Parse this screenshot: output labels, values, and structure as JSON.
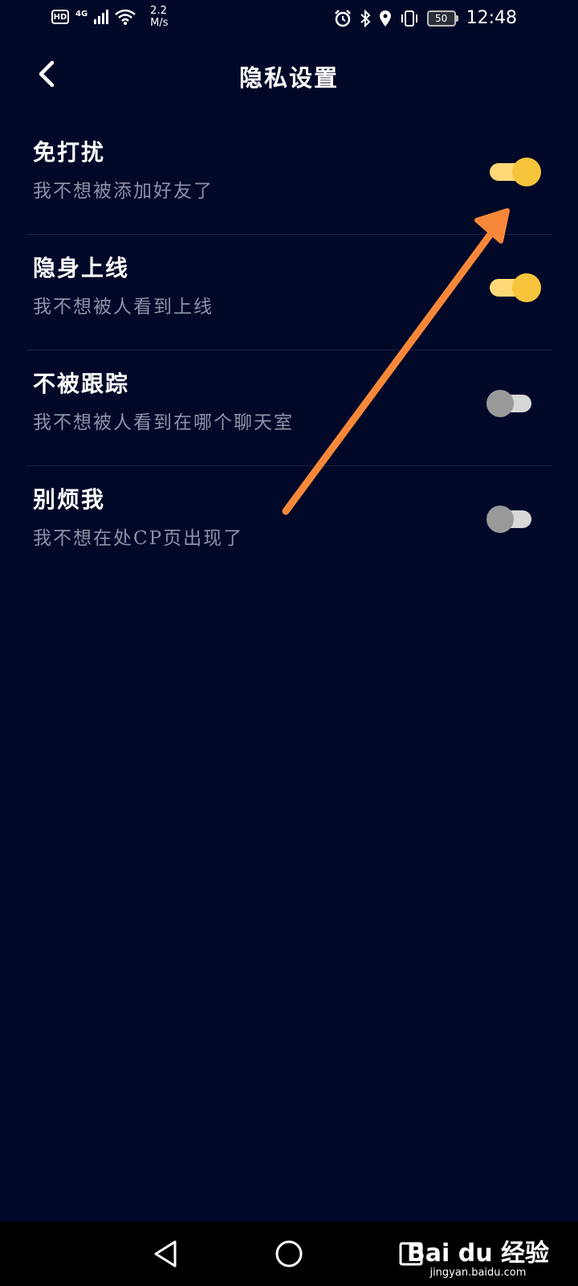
{
  "status_bar": {
    "hd": "HD",
    "network": "4G",
    "speed_value": "2.2",
    "speed_unit": "M/s",
    "battery": "50",
    "time": "12:48"
  },
  "header": {
    "title": "隐私设置"
  },
  "settings": [
    {
      "title": "免打扰",
      "description": "我不想被添加好友了",
      "enabled": true
    },
    {
      "title": "隐身上线",
      "description": "我不想被人看到上线",
      "enabled": true
    },
    {
      "title": "不被跟踪",
      "description": "我不想被人看到在哪个聊天室",
      "enabled": false
    },
    {
      "title": "别烦我",
      "description": "我不想在处CP页出现了",
      "enabled": false
    }
  ],
  "colors": {
    "background": "#020828",
    "toggle_on_knob": "#f7c43c",
    "toggle_on_track": "#ffd978",
    "toggle_off_knob": "#999999",
    "toggle_off_track": "#d8d8d8",
    "annotation_arrow": "#f7883a"
  },
  "icons": {
    "back": "chevron-left-icon",
    "nav_back": "triangle-back-icon",
    "nav_home": "circle-home-icon",
    "nav_recents": "square-recents-icon"
  },
  "watermark": {
    "logo": "Bai du 经验",
    "url": "jingyan.baidu.com"
  }
}
